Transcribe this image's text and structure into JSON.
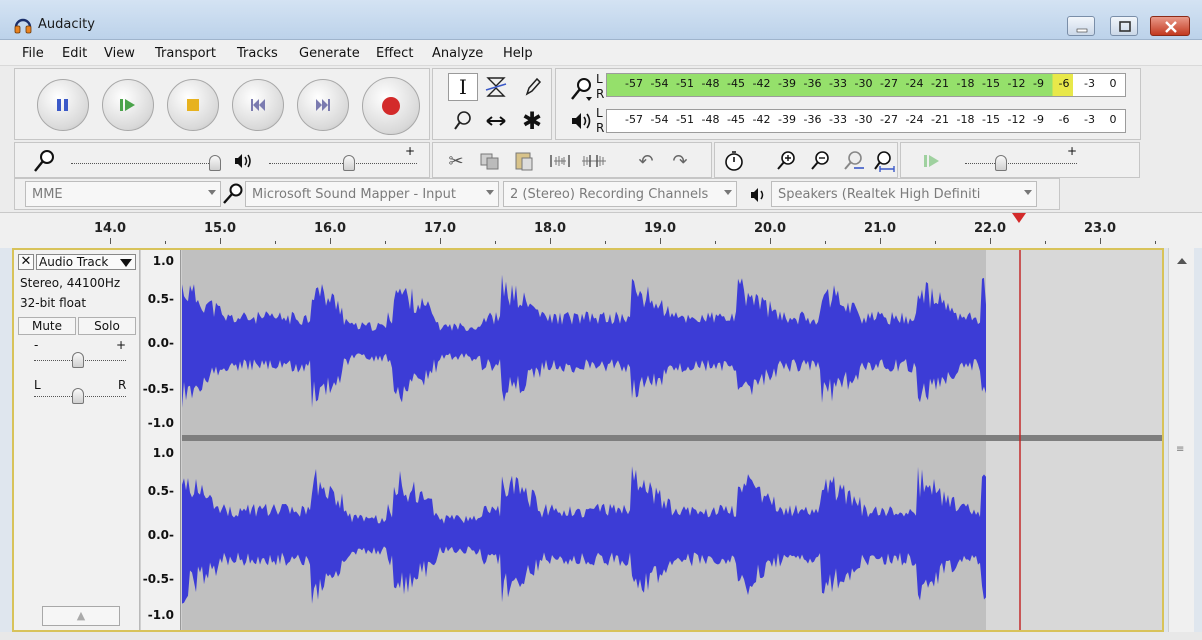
{
  "window": {
    "title": "Audacity"
  },
  "menu": [
    "File",
    "Edit",
    "View",
    "Transport",
    "Tracks",
    "Generate",
    "Effect",
    "Analyze",
    "Help"
  ],
  "meters": {
    "record_channels": [
      "L",
      "R"
    ],
    "play_channels": [
      "L",
      "R"
    ],
    "scale": [
      "-57",
      "-54",
      "-51",
      "-48",
      "-45",
      "-42",
      "-39",
      "-36",
      "-33",
      "-30",
      "-27",
      "-24",
      "-21",
      "-18",
      "-15",
      "-12",
      "-9",
      "-6",
      "-3",
      "0"
    ]
  },
  "mixer": {
    "plus": "+"
  },
  "devices": {
    "host": "MME",
    "input": "Microsoft Sound Mapper - Input",
    "channels": "2 (Stereo) Recording Channels",
    "output": "Speakers (Realtek High Definiti"
  },
  "ruler": {
    "labels": [
      "14.0",
      "15.0",
      "16.0",
      "17.0",
      "18.0",
      "19.0",
      "20.0",
      "21.0",
      "22.0",
      "23.0"
    ]
  },
  "track": {
    "name": "Audio Track",
    "info1": "Stereo, 44100Hz",
    "info2": "32-bit float",
    "mute": "Mute",
    "solo": "Solo",
    "gain_minus": "-",
    "gain_plus": "+",
    "pan_left": "L",
    "pan_right": "R",
    "collapse_glyph": "▲"
  },
  "vruler": [
    "1.0",
    "0.5-",
    "0.0-",
    "-0.5-",
    "-1.0"
  ],
  "colors": {
    "wave": "#3c3cd6",
    "selection_bg": "#c0c0c0",
    "unselected_bg": "#d8d8d8",
    "cursor": "#c21f1f",
    "meter_green": "#95e06b"
  }
}
